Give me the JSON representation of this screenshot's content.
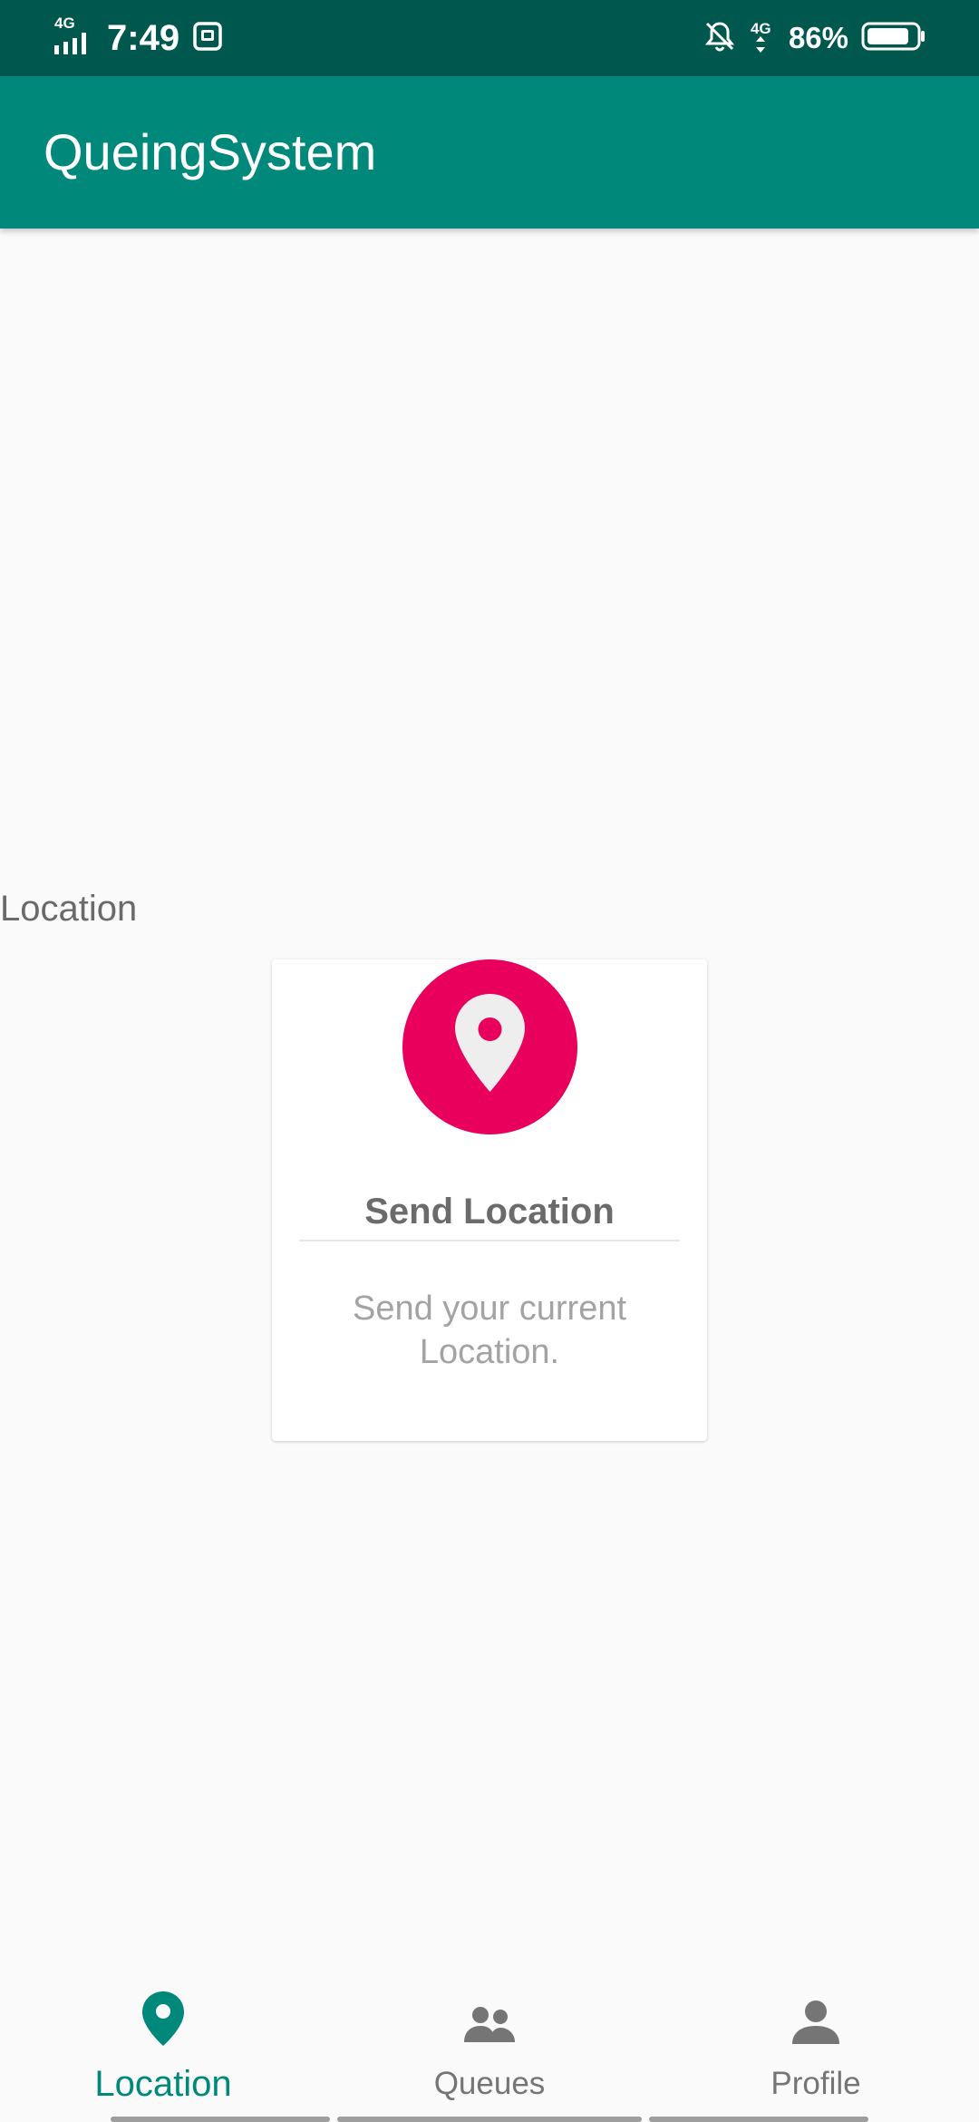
{
  "status_bar": {
    "network_left": "4G",
    "time": "7:49",
    "network_right": "4G",
    "battery": "86%",
    "battery_level": 0.86
  },
  "app_bar": {
    "title": "QueingSystem"
  },
  "main": {
    "section_label": "Location",
    "card": {
      "icon": "map-pin-icon",
      "icon_color": "#e8005c",
      "title": "Send Location",
      "description": "Send your current Location."
    }
  },
  "bottom_nav": {
    "items": [
      {
        "label": "Location",
        "icon": "map-pin-icon",
        "active": true
      },
      {
        "label": "Queues",
        "icon": "people-icon",
        "active": false
      },
      {
        "label": "Profile",
        "icon": "person-icon",
        "active": false
      }
    ],
    "active_color": "#00897b",
    "inactive_color": "#757575"
  },
  "colors": {
    "primary": "#00897b",
    "primary_dark": "#00574d",
    "accent": "#e8005c"
  }
}
